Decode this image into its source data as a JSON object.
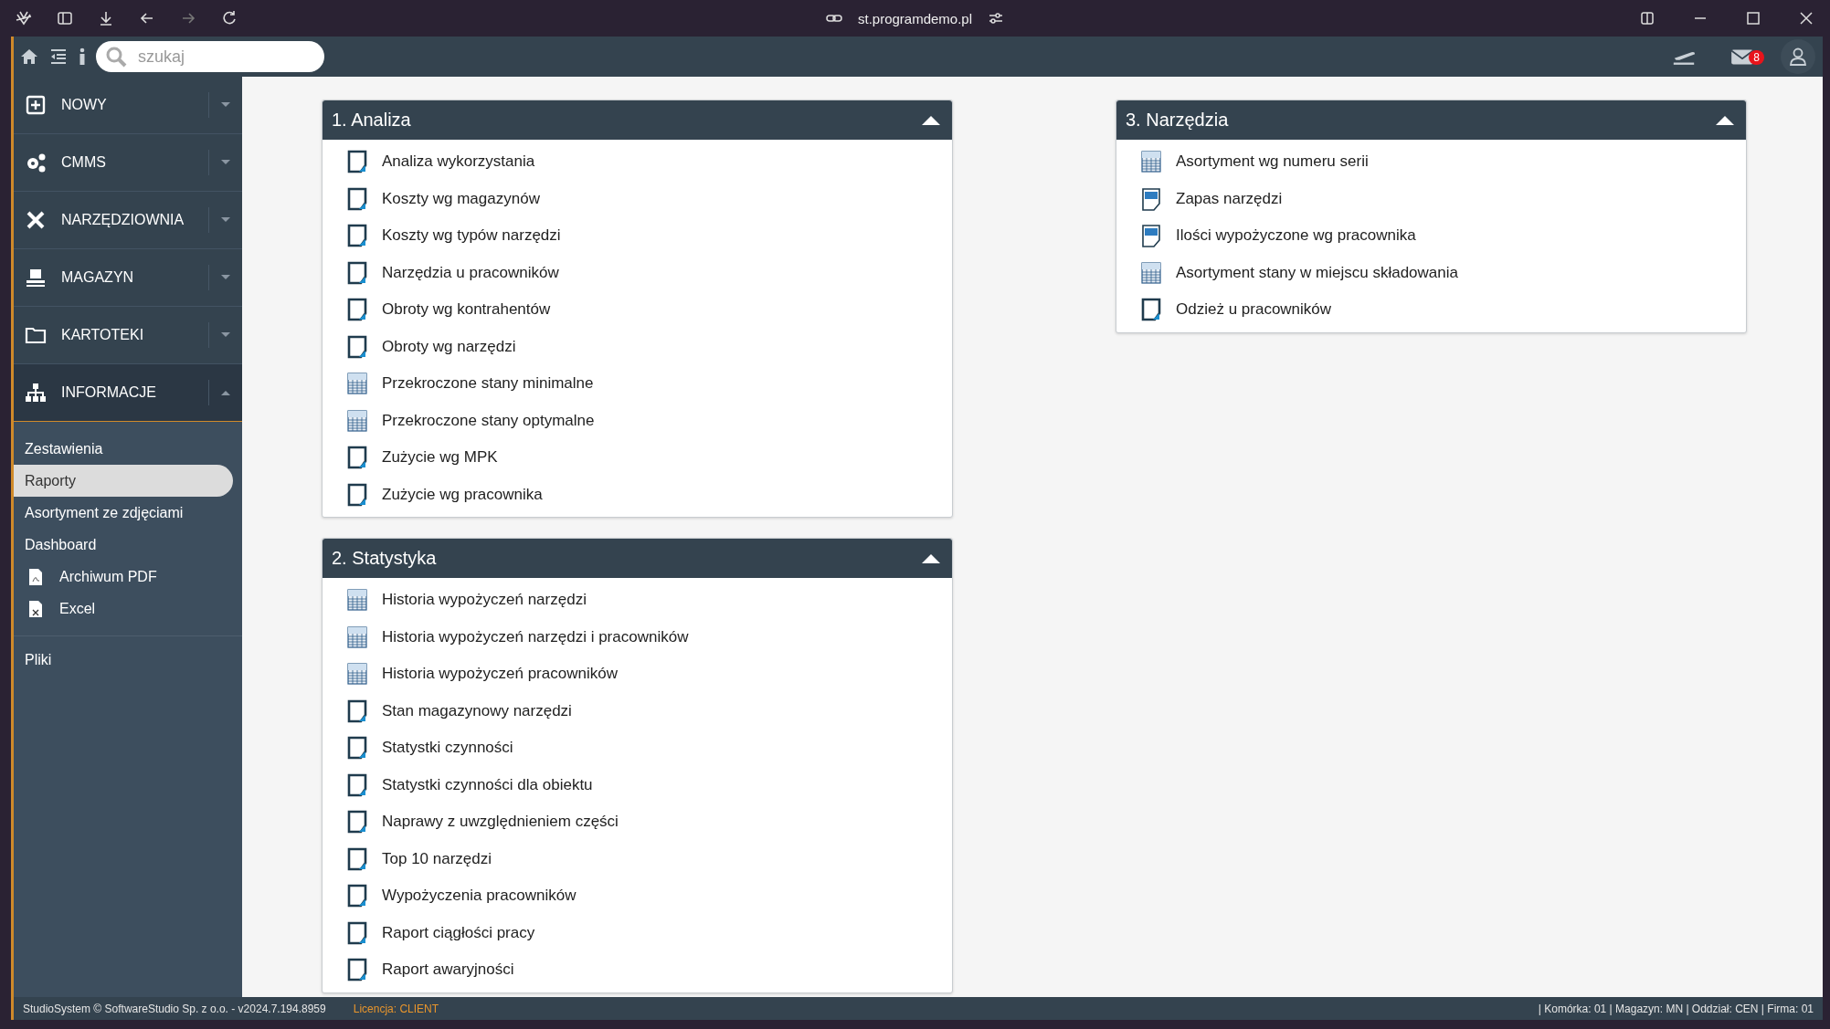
{
  "browser": {
    "url": "st.programdemo.pl"
  },
  "toolbar": {
    "search_placeholder": "szukaj",
    "mail_count": "8"
  },
  "sidebar": {
    "menu": [
      {
        "label": "NOWY",
        "expanded": false
      },
      {
        "label": "CMMS",
        "expanded": false
      },
      {
        "label": "NARZĘDZIOWNIA",
        "expanded": false
      },
      {
        "label": "MAGAZYN",
        "expanded": false
      },
      {
        "label": "KARTOTEKI",
        "expanded": false
      },
      {
        "label": "INFORMACJE",
        "expanded": true,
        "children": [
          {
            "label": "Zestawienia",
            "kind": "text",
            "selected": false
          },
          {
            "label": "Raporty",
            "kind": "text",
            "selected": true
          },
          {
            "label": "Asortyment ze zdjęciami",
            "kind": "text",
            "selected": false
          },
          {
            "label": "Dashboard",
            "kind": "text",
            "selected": false
          },
          {
            "label": "Archiwum PDF",
            "kind": "pdf",
            "selected": false
          },
          {
            "label": "Excel",
            "kind": "excel",
            "selected": false
          }
        ]
      }
    ],
    "extra": [
      {
        "label": "Pliki"
      }
    ]
  },
  "columns": [
    {
      "panels": [
        {
          "title": "1. Analiza",
          "expanded": true,
          "items": [
            {
              "label": "Analiza wykorzystania",
              "kind": "doc"
            },
            {
              "label": "Koszty wg magazynów",
              "kind": "doc"
            },
            {
              "label": "Koszty wg typów narzędzi",
              "kind": "doc"
            },
            {
              "label": "Narzędzia u pracowników",
              "kind": "doc"
            },
            {
              "label": "Obroty wg kontrahentów",
              "kind": "doc"
            },
            {
              "label": "Obroty wg narzędzi",
              "kind": "doc"
            },
            {
              "label": "Przekroczone stany minimalne",
              "kind": "xls"
            },
            {
              "label": "Przekroczone stany optymalne",
              "kind": "xls"
            },
            {
              "label": "Zużycie wg MPK",
              "kind": "doc"
            },
            {
              "label": "Zużycie wg pracownika",
              "kind": "doc"
            }
          ]
        },
        {
          "title": "2. Statystyka",
          "expanded": true,
          "items": [
            {
              "label": "Historia wypożyczeń narzędzi",
              "kind": "xls"
            },
            {
              "label": "Historia wypożyczeń narzędzi i pracowników",
              "kind": "xls"
            },
            {
              "label": "Historia wypożyczeń pracowników",
              "kind": "xls"
            },
            {
              "label": "Stan magazynowy narzędzi",
              "kind": "doc"
            },
            {
              "label": "Statystki czynności",
              "kind": "doc"
            },
            {
              "label": "Statystki czynności dla obiektu",
              "kind": "doc"
            },
            {
              "label": "Naprawy z uwzględnieniem części",
              "kind": "doc"
            },
            {
              "label": "Top 10 narzędzi",
              "kind": "doc"
            },
            {
              "label": "Wypożyczenia pracowników",
              "kind": "doc"
            },
            {
              "label": "Raport ciągłości pracy",
              "kind": "doc"
            },
            {
              "label": "Raport awaryjności",
              "kind": "doc"
            }
          ]
        }
      ]
    },
    {
      "panels": [
        {
          "title": "3. Narzędzia",
          "expanded": true,
          "items": [
            {
              "label": "Asortyment wg numeru serii",
              "kind": "xls"
            },
            {
              "label": "Zapas narzędzi",
              "kind": "pdf"
            },
            {
              "label": "Ilości wypożyczone wg pracownika",
              "kind": "pdf"
            },
            {
              "label": "Asortyment stany w miejscu składowania",
              "kind": "xls"
            },
            {
              "label": "Odzież u pracowników",
              "kind": "doc"
            }
          ]
        }
      ]
    }
  ],
  "status_bar": {
    "left": "StudioSystem © SoftwareStudio Sp. z o.o. - v2024.7.194.8959",
    "license": "Licencja: CLIENT",
    "right": "| Komórka: 01 | Magazyn: MN | Oddział: CEN | Firma: 01"
  }
}
